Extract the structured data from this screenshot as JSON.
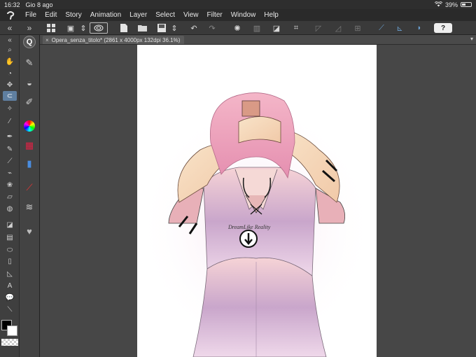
{
  "status_bar": {
    "time": "16:32",
    "date": "Gio 8 ago",
    "battery": "39%",
    "battery_level": 0.39
  },
  "menu": {
    "app_icon": "clip-studio-logo",
    "items": [
      "File",
      "Edit",
      "Story",
      "Animation",
      "Layer",
      "Select",
      "View",
      "Filter",
      "Window",
      "Help"
    ]
  },
  "toolbar": {
    "help_label": "?"
  },
  "document": {
    "tab_title": "Opera_senza_titolo* (2861 x 4000px 132dpi 36.1%)",
    "close_glyph": "×",
    "menu_glyph": "▾"
  },
  "artwork": {
    "signature": "DreamLike Reality"
  },
  "colors": {
    "foreground": "#000000",
    "background": "#ffffff",
    "accent": "#5f7fa0"
  }
}
